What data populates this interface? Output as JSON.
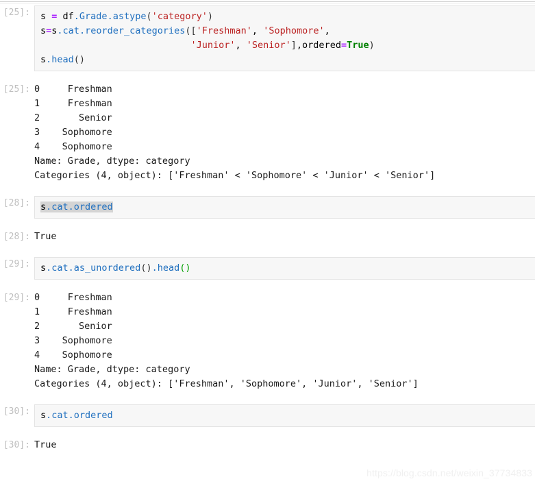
{
  "notebook": {
    "watermark": "https://blog.csdn.net/weixin_37734833",
    "colors": {
      "prompt": "#bfbfbf",
      "input_background": "#f7f7f7",
      "input_border": "#e3e3e3",
      "string": "#bb2222",
      "attribute": "#1f6fbf",
      "operator": "#aa22ff",
      "keyword": "#008000",
      "selection": "#d4d4d4",
      "page_background": "#ffffff"
    },
    "cells": [
      {
        "id": "cell-25",
        "input_prompt": "[25]:",
        "output_prompt": "[25]:",
        "input_lines": [
          "s = df.Grade.astype('category')",
          "s=s.cat.reorder_categories(['Freshman', 'Sophomore',",
          "                           'Junior', 'Senior'],ordered=True)",
          "s.head()"
        ],
        "output_lines": [
          "0     Freshman",
          "1     Freshman",
          "2       Senior",
          "3    Sophomore",
          "4    Sophomore",
          "Name: Grade, dtype: category",
          "Categories (4, object): ['Freshman' < 'Sophomore' < 'Junior' < 'Senior']"
        ]
      },
      {
        "id": "cell-28",
        "input_prompt": "[28]:",
        "output_prompt": "[28]:",
        "input_lines": [
          "s.cat.ordered"
        ],
        "selected": true,
        "output_lines": [
          "True"
        ]
      },
      {
        "id": "cell-29",
        "input_prompt": "[29]:",
        "output_prompt": "[29]:",
        "input_lines": [
          "s.cat.as_unordered().head()"
        ],
        "output_lines": [
          "0     Freshman",
          "1     Freshman",
          "2       Senior",
          "3    Sophomore",
          "4    Sophomore",
          "Name: Grade, dtype: category",
          "Categories (4, object): ['Freshman', 'Sophomore', 'Junior', 'Senior']"
        ]
      },
      {
        "id": "cell-30",
        "input_prompt": "[30]:",
        "output_prompt": "[30]:",
        "input_lines": [
          "s.cat.ordered"
        ],
        "output_lines": [
          "True"
        ]
      }
    ]
  }
}
